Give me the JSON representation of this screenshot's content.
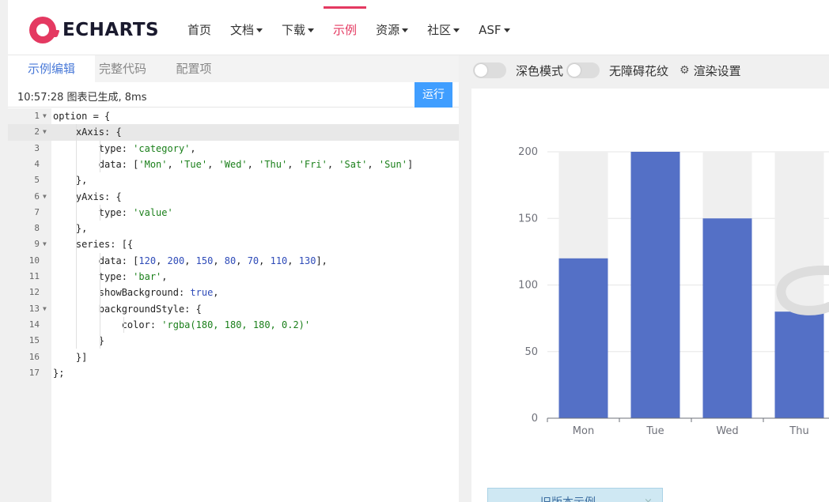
{
  "brand": {
    "logo_text": "ECHARTS",
    "accent": "#e43961"
  },
  "nav": [
    {
      "label": "首页",
      "dropdown": false,
      "active": false
    },
    {
      "label": "文档",
      "dropdown": true,
      "active": false
    },
    {
      "label": "下载",
      "dropdown": true,
      "active": false
    },
    {
      "label": "示例",
      "dropdown": false,
      "active": true
    },
    {
      "label": "资源",
      "dropdown": true,
      "active": false
    },
    {
      "label": "社区",
      "dropdown": true,
      "active": false
    },
    {
      "label": "ASF",
      "dropdown": true,
      "active": false
    }
  ],
  "editor": {
    "tabs": [
      "示例编辑",
      "完整代码",
      "配置项"
    ],
    "status": "10:57:28  图表已生成, 8ms",
    "run_label": "运行",
    "lines": [
      "option = {",
      "    xAxis: {",
      "        type: 'category',",
      "        data: ['Mon', 'Tue', 'Wed', 'Thu', 'Fri', 'Sat', 'Sun']",
      "    },",
      "    yAxis: {",
      "        type: 'value'",
      "    },",
      "    series: [{",
      "        data: [120, 200, 150, 80, 70, 110, 130],",
      "        type: 'bar',",
      "        showBackground: true,",
      "        backgroundStyle: {",
      "            color: 'rgba(180, 180, 180, 0.2)'",
      "        }",
      "    }]",
      "};"
    ],
    "foldable_lines": [
      1,
      2,
      6,
      9,
      13
    ],
    "highlighted_line": 2
  },
  "controls": {
    "dark_mode": "深色模式",
    "decal": "无障碍花纹",
    "render_settings": "渲染设置"
  },
  "old_version": {
    "label": "旧版本示例",
    "close": "×"
  },
  "chart_data": {
    "type": "bar",
    "categories": [
      "Mon",
      "Tue",
      "Wed",
      "Thu"
    ],
    "values": [
      120,
      200,
      150,
      80
    ],
    "ylim": [
      0,
      200
    ],
    "yticks": [
      0,
      50,
      100,
      150,
      200
    ],
    "bar_color": "#5470c6",
    "background_color": "#efefef",
    "grid": true
  }
}
